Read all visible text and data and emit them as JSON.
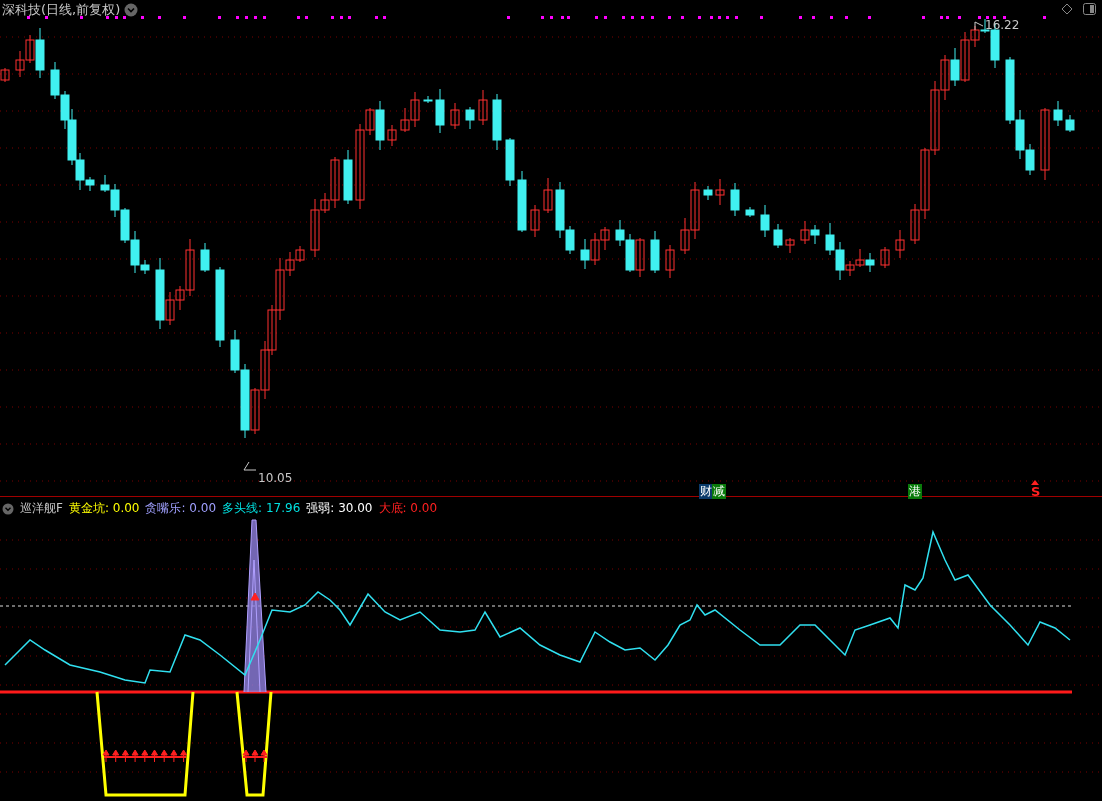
{
  "stock": {
    "title": "深科技(日线,前复权)",
    "high_label": "16.22",
    "low_label": "10.05"
  },
  "signal_badges": [
    {
      "text": "财",
      "color": "#0b3a6a"
    },
    {
      "text": "减",
      "color": "#0a7a0a"
    },
    {
      "text": "港",
      "color": "#0a7a0a"
    }
  ],
  "sell_mark": "S",
  "indicator": {
    "name": "巡洋舰F",
    "values": [
      {
        "label": "黄金坑:",
        "value": "0.00",
        "color": "#ffff00"
      },
      {
        "label": "贪嘴乐:",
        "value": "0.00",
        "color": "#a0a0ff"
      },
      {
        "label": "多头线:",
        "value": "17.96",
        "color": "#00e0e0"
      },
      {
        "label": "强弱:",
        "value": "30.00",
        "color": "#ffffff"
      },
      {
        "label": "大底:",
        "value": "0.00",
        "color": "#ff2020"
      }
    ]
  }
}
